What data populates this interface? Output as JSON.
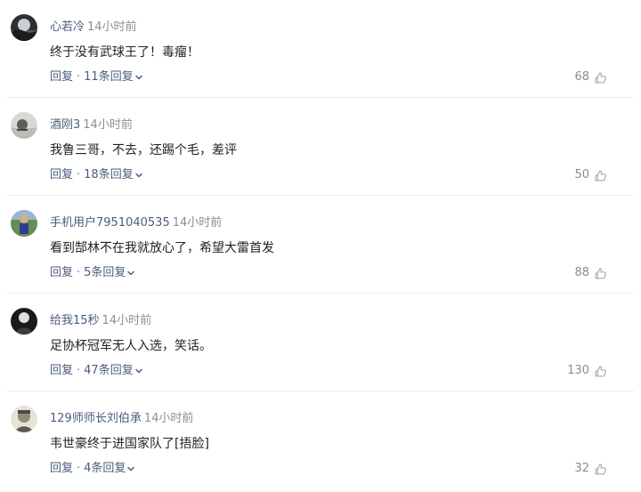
{
  "ui": {
    "reply_label": "回复",
    "dot": "·",
    "colors": {
      "username": "#4b5d7a",
      "meta": "#8e8e8e",
      "text": "#222222",
      "divider": "#ececec",
      "like": "#8b8b8b"
    },
    "icons": {
      "like": "thumb-up-icon",
      "expand": "chevron-down-icon"
    }
  },
  "comments": [
    {
      "username": "心若冷",
      "time": "14小时前",
      "text": "终于没有武球王了！毒瘤！",
      "replies": "11条回复",
      "likes": "68",
      "avatar": "dark-landscape-avatar"
    },
    {
      "username": "酒刚3",
      "time": "14小时前",
      "text": "我鲁三哥，不去，还踢个毛，差评",
      "replies": "18条回复",
      "likes": "50",
      "avatar": "gray-dusk-avatar"
    },
    {
      "username": "手机用户7951040535",
      "time": "14小时前",
      "text": "看到郜林不在我就放心了，希望大雷首发",
      "replies": "5条回复",
      "likes": "88",
      "avatar": "sports-photo-avatar"
    },
    {
      "username": "给我15秒",
      "time": "14小时前",
      "text": "足协杯冠军无人入选，笑话。",
      "replies": "47条回复",
      "likes": "130",
      "avatar": "dark-portrait-avatar"
    },
    {
      "username": "129师师长刘伯承",
      "time": "14小时前",
      "text": "韦世豪终于进国家队了[捂脸]",
      "replies": "4条回复",
      "likes": "32",
      "avatar": "vintage-portrait-avatar"
    }
  ]
}
